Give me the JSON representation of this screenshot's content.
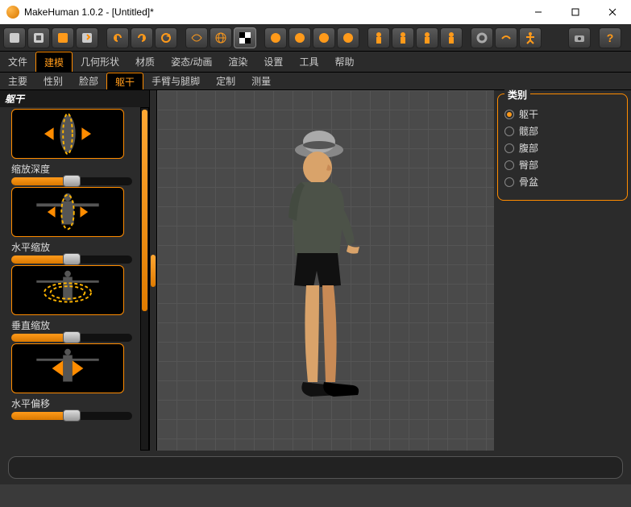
{
  "titlebar": {
    "title": "MakeHuman 1.0.2 - [Untitled]*"
  },
  "menubar": {
    "items": [
      {
        "label": "文件"
      },
      {
        "label": "建模",
        "active": true
      },
      {
        "label": "几何形状"
      },
      {
        "label": "材质"
      },
      {
        "label": "姿态/动画"
      },
      {
        "label": "渲染"
      },
      {
        "label": "设置"
      },
      {
        "label": "工具"
      },
      {
        "label": "帮助"
      }
    ]
  },
  "subtabs": {
    "items": [
      {
        "label": "主要"
      },
      {
        "label": "性别"
      },
      {
        "label": "脸部"
      },
      {
        "label": "躯干",
        "active": true
      },
      {
        "label": "手臂与腿脚"
      },
      {
        "label": "定制"
      },
      {
        "label": "测量"
      }
    ]
  },
  "left": {
    "header": "躯干",
    "sliders": [
      {
        "label": "",
        "value": 0.5,
        "thumb": "vert-squeeze"
      },
      {
        "label": "缩放深度",
        "value": 0.5,
        "thumb": "arms-out"
      },
      {
        "label": "水平缩放",
        "value": 0.5,
        "thumb": "hoop"
      },
      {
        "label": "垂直缩放",
        "value": 0.5,
        "thumb": "shift"
      },
      {
        "label": "水平偏移",
        "value": 0.5,
        "thumb": null
      }
    ]
  },
  "right": {
    "title": "类别",
    "radios": [
      {
        "label": "躯干",
        "checked": true
      },
      {
        "label": "髋部",
        "checked": false
      },
      {
        "label": "腹部",
        "checked": false
      },
      {
        "label": "臀部",
        "checked": false
      },
      {
        "label": "骨盆",
        "checked": false
      }
    ]
  },
  "icons": {
    "toolbar_groups": [
      [
        "new",
        "open",
        "save",
        "export"
      ],
      [
        "undo",
        "redo",
        "refresh"
      ],
      [
        "wire",
        "globe",
        "checker"
      ],
      [
        "head-left",
        "head-front",
        "head-back",
        "head-right"
      ],
      [
        "body-left",
        "body-front",
        "body-back",
        "body-right"
      ],
      [
        "gear",
        "hands",
        "pose"
      ],
      [
        "camera"
      ],
      [
        "help"
      ]
    ]
  },
  "colors": {
    "accent": "#ff8c00"
  }
}
